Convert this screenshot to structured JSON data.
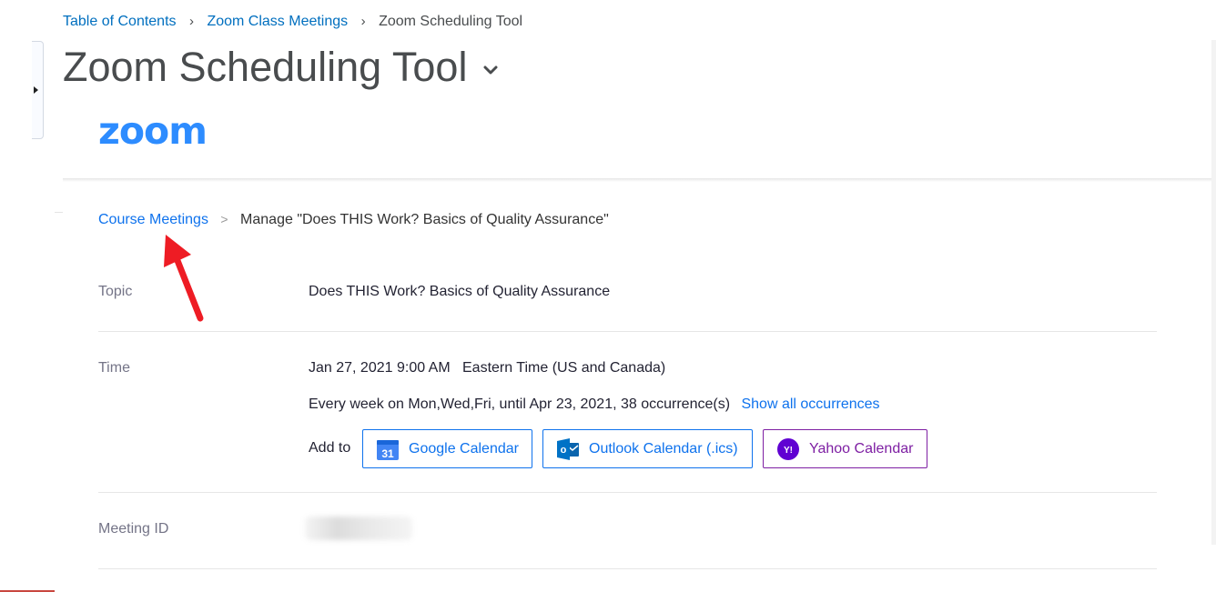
{
  "top_breadcrumb": {
    "items": [
      "Table of Contents",
      "Zoom Class Meetings"
    ],
    "current": "Zoom Scheduling Tool"
  },
  "page": {
    "title": "Zoom Scheduling Tool"
  },
  "logo": {
    "text": "zoom"
  },
  "meeting_breadcrumb": {
    "link": "Course Meetings",
    "separator": ">",
    "current": "Manage \"Does THIS Work? Basics of Quality Assurance\""
  },
  "details": {
    "topic_label": "Topic",
    "topic_value": "Does THIS Work? Basics of Quality Assurance",
    "time_label": "Time",
    "time_value": "Jan 27, 2021 9:00 AM   Eastern Time (US and Canada)",
    "recurrence": "Every week on Mon,Wed,Fri, until Apr 23, 2021, 38 occurrence(s)",
    "show_all_link": "Show all occurrences",
    "add_to_label": "Add to",
    "calendars": {
      "google": "Google Calendar",
      "google_icon_text": "31",
      "outlook": "Outlook Calendar (.ics)",
      "outlook_icon_text": "o",
      "yahoo": "Yahoo Calendar",
      "yahoo_icon_text": "Y!"
    },
    "meeting_id_label": "Meeting ID"
  },
  "colors": {
    "accent": "#0e72ed",
    "zoom_blue": "#2d8cff",
    "yahoo_purple": "#7e1fa3",
    "annotation_red": "#ee1c24"
  }
}
